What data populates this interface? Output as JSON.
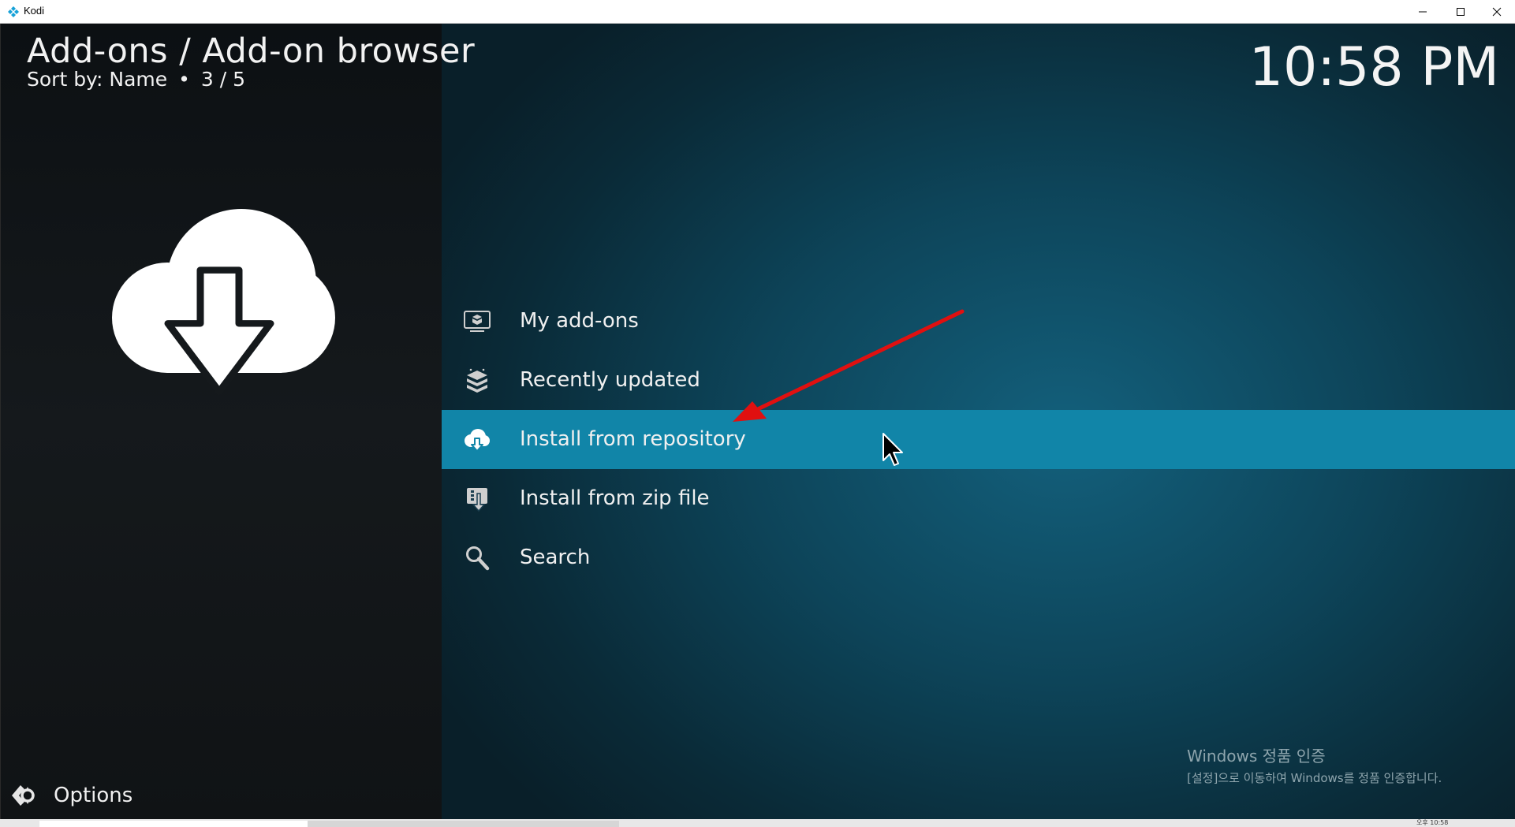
{
  "window": {
    "title": "Kodi",
    "controls": {
      "minimize": "minimize-icon",
      "maximize": "maximize-icon",
      "close": "close-icon"
    }
  },
  "header": {
    "breadcrumb": "Add-ons / Add-on browser",
    "sort_label": "Sort by: Name",
    "bullet": "•",
    "position": "3 / 5",
    "clock": "10:58 PM"
  },
  "preview": {
    "icon": "cloud-download-icon"
  },
  "menu": {
    "items": [
      {
        "label": "My add-ons",
        "icon": "monitor-box-icon",
        "selected": false
      },
      {
        "label": "Recently updated",
        "icon": "stacked-boxes-icon",
        "selected": false
      },
      {
        "label": "Install from repository",
        "icon": "cloud-download-icon",
        "selected": true
      },
      {
        "label": "Install from zip file",
        "icon": "zip-install-icon",
        "selected": false
      },
      {
        "label": "Search",
        "icon": "search-icon",
        "selected": false
      }
    ]
  },
  "footer": {
    "options_label": "Options",
    "options_icon": "options-icon"
  },
  "watermark": {
    "line1": "Windows 정품 인증",
    "line2": "[설정]으로 이동하여 Windows를 정품 인증합니다."
  },
  "taskbar": {
    "tray_time": "오후 10:58"
  },
  "colors": {
    "accent": "#1185a8",
    "annotation_arrow": "#e01010",
    "text": "#f0f0f0"
  }
}
